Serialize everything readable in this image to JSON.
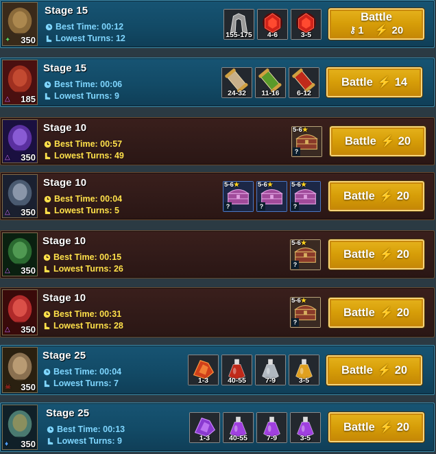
{
  "rows": [
    {
      "theme": "blue",
      "stage": "Stage 15",
      "best_time_label": "Best Time: 00:12",
      "lowest_turns_label": "Lowest Turns: 12",
      "level": "350",
      "level_icon": "green-leaf-icon",
      "rewards": [
        {
          "kind": "shard",
          "range": "155-175",
          "icon": "silver-crest-icon"
        },
        {
          "kind": "gem",
          "range": "4-6",
          "icon": "red-gem-icon"
        },
        {
          "kind": "gem",
          "range": "3-5",
          "icon": "red-gem-icon"
        }
      ],
      "battle": {
        "label": "Battle",
        "keys": "1",
        "energy": "20"
      }
    },
    {
      "theme": "blue",
      "stage": "Stage 15",
      "best_time_label": "Best Time: 00:06",
      "lowest_turns_label": "Lowest Turns: 9",
      "level": "185",
      "level_icon": "purple-triangle-icon",
      "rewards": [
        {
          "kind": "scroll",
          "range": "24-32",
          "icon": "parchment-scroll-icon"
        },
        {
          "kind": "scroll",
          "range": "11-16",
          "icon": "green-scroll-icon"
        },
        {
          "kind": "scroll",
          "range": "6-12",
          "icon": "red-scroll-icon"
        }
      ],
      "battle": {
        "label": "Battle",
        "energy": "14"
      }
    },
    {
      "theme": "brown",
      "stage": "Stage 10",
      "best_time_label": "Best Time: 00:57",
      "lowest_turns_label": "Lowest Turns: 49",
      "level": "350",
      "level_icon": "purple-triangle-icon",
      "rewards": [
        {
          "kind": "chest",
          "stars": "5-6",
          "icon": "treasure-chest-icon",
          "q": "?"
        }
      ],
      "battle": {
        "label": "Battle",
        "energy": "20"
      }
    },
    {
      "theme": "brown",
      "stage": "Stage 10",
      "best_time_label": "Best Time: 00:04",
      "lowest_turns_label": "Lowest Turns: 5",
      "level": "350",
      "level_icon": "purple-triangle-icon",
      "rewards": [
        {
          "kind": "chest-blue",
          "stars": "5-6",
          "icon": "pink-chest-icon",
          "q": "?"
        },
        {
          "kind": "chest-blue",
          "stars": "5-6",
          "icon": "pink-chest-icon",
          "q": "?"
        },
        {
          "kind": "chest-blue",
          "stars": "5-6",
          "icon": "pink-chest-icon",
          "q": "?"
        }
      ],
      "battle": {
        "label": "Battle",
        "energy": "20"
      }
    },
    {
      "theme": "brown",
      "stage": "Stage 10",
      "best_time_label": "Best Time: 00:15",
      "lowest_turns_label": "Lowest Turns: 26",
      "level": "350",
      "level_icon": "purple-triangle-icon",
      "rewards": [
        {
          "kind": "chest",
          "stars": "5-6",
          "icon": "treasure-chest-icon",
          "q": "?"
        }
      ],
      "battle": {
        "label": "Battle",
        "energy": "20"
      }
    },
    {
      "theme": "brown",
      "stage": "Stage 10",
      "best_time_label": "Best Time: 00:31",
      "lowest_turns_label": "Lowest Turns: 28",
      "level": "350",
      "level_icon": "purple-triangle-icon",
      "rewards": [
        {
          "kind": "chest",
          "stars": "5-6",
          "icon": "treasure-chest-icon",
          "q": "?"
        }
      ],
      "battle": {
        "label": "Battle",
        "energy": "20"
      }
    },
    {
      "theme": "blue",
      "stage": "Stage 25",
      "best_time_label": "Best Time: 00:04",
      "lowest_turns_label": "Lowest Turns: 7",
      "level": "350",
      "level_icon": "red-skull-icon",
      "rewards": [
        {
          "kind": "shard",
          "range": "1-3",
          "icon": "red-shard-icon"
        },
        {
          "kind": "potion",
          "range": "40-55",
          "icon": "red-potion-icon"
        },
        {
          "kind": "potion",
          "range": "7-9",
          "icon": "silver-potion-icon"
        },
        {
          "kind": "potion",
          "range": "3-5",
          "icon": "gold-potion-icon"
        }
      ],
      "battle": {
        "label": "Battle",
        "energy": "20"
      }
    },
    {
      "theme": "blue",
      "stage": "Stage 25",
      "best_time_label": "Best Time: 00:13",
      "lowest_turns_label": "Lowest Turns: 9",
      "level": "350",
      "level_icon": "blue-drop-icon",
      "rewards": [
        {
          "kind": "shard",
          "range": "1-3",
          "icon": "purple-shard-icon"
        },
        {
          "kind": "potion",
          "range": "40-55",
          "icon": "purple-potion-icon"
        },
        {
          "kind": "potion",
          "range": "7-9",
          "icon": "purple-potion-icon"
        },
        {
          "kind": "potion",
          "range": "3-5",
          "icon": "purple-potion-icon"
        }
      ],
      "battle": {
        "label": "Battle",
        "energy": "20"
      }
    }
  ],
  "colors": {
    "accent_gold": "#d69d08",
    "stat_blue": "#7fd6ff",
    "stat_yellow": "#ffe14a",
    "energy": "#ffe83a"
  },
  "icons": {
    "time": "clock-icon",
    "turns": "boot-icon",
    "energy": "lightning-icon",
    "key": "key-icon"
  }
}
